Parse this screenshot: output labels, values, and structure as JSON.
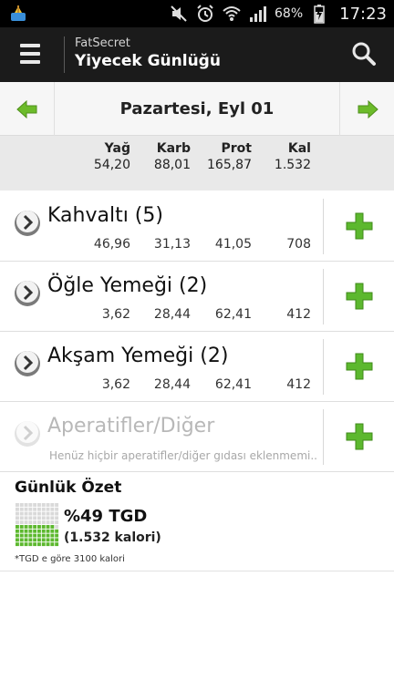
{
  "status_bar": {
    "battery": "68%",
    "time": "17:23",
    "icons": [
      "cleaner-app-icon",
      "mute-icon",
      "alarm-icon",
      "wifi-icon",
      "signal-icon",
      "battery-charging-icon"
    ]
  },
  "app_bar": {
    "app_name": "FatSecret",
    "title": "Yiyecek Günlüğü",
    "icons": [
      "menu-icon",
      "search-icon"
    ]
  },
  "date_nav": {
    "date": "Pazartesi, Eyl 01",
    "icons": [
      "arrow-left-icon",
      "arrow-right-icon"
    ]
  },
  "totals": {
    "headers": [
      "Yağ",
      "Karb",
      "Prot",
      "Kal"
    ],
    "values": [
      "54,20",
      "88,01",
      "165,87",
      "1.532"
    ]
  },
  "meals": [
    {
      "name": "Kahvaltı (5)",
      "values": [
        "46,96",
        "31,13",
        "41,05",
        "708"
      ]
    },
    {
      "name": "Öğle Yemeği (2)",
      "values": [
        "3,62",
        "28,44",
        "62,41",
        "412"
      ]
    },
    {
      "name": "Akşam Yemeği (2)",
      "values": [
        "3,62",
        "28,44",
        "62,41",
        "412"
      ]
    },
    {
      "name": "Aperatifler/Diğer",
      "empty_text": "Henüz hiçbir aperatifler/diğer gıdası eklenmemi..."
    }
  ],
  "summary": {
    "title": "Günlük Özet",
    "rdi_percent": "%49 TGD",
    "calories": "(1.532 kalori)",
    "note": "*TGD e göre 3100 kalori",
    "rdi_fraction": 0.49
  },
  "colors": {
    "accent_green": "#5cb82e",
    "app_bar": "#1b1b1b",
    "status_bar": "#000000"
  }
}
